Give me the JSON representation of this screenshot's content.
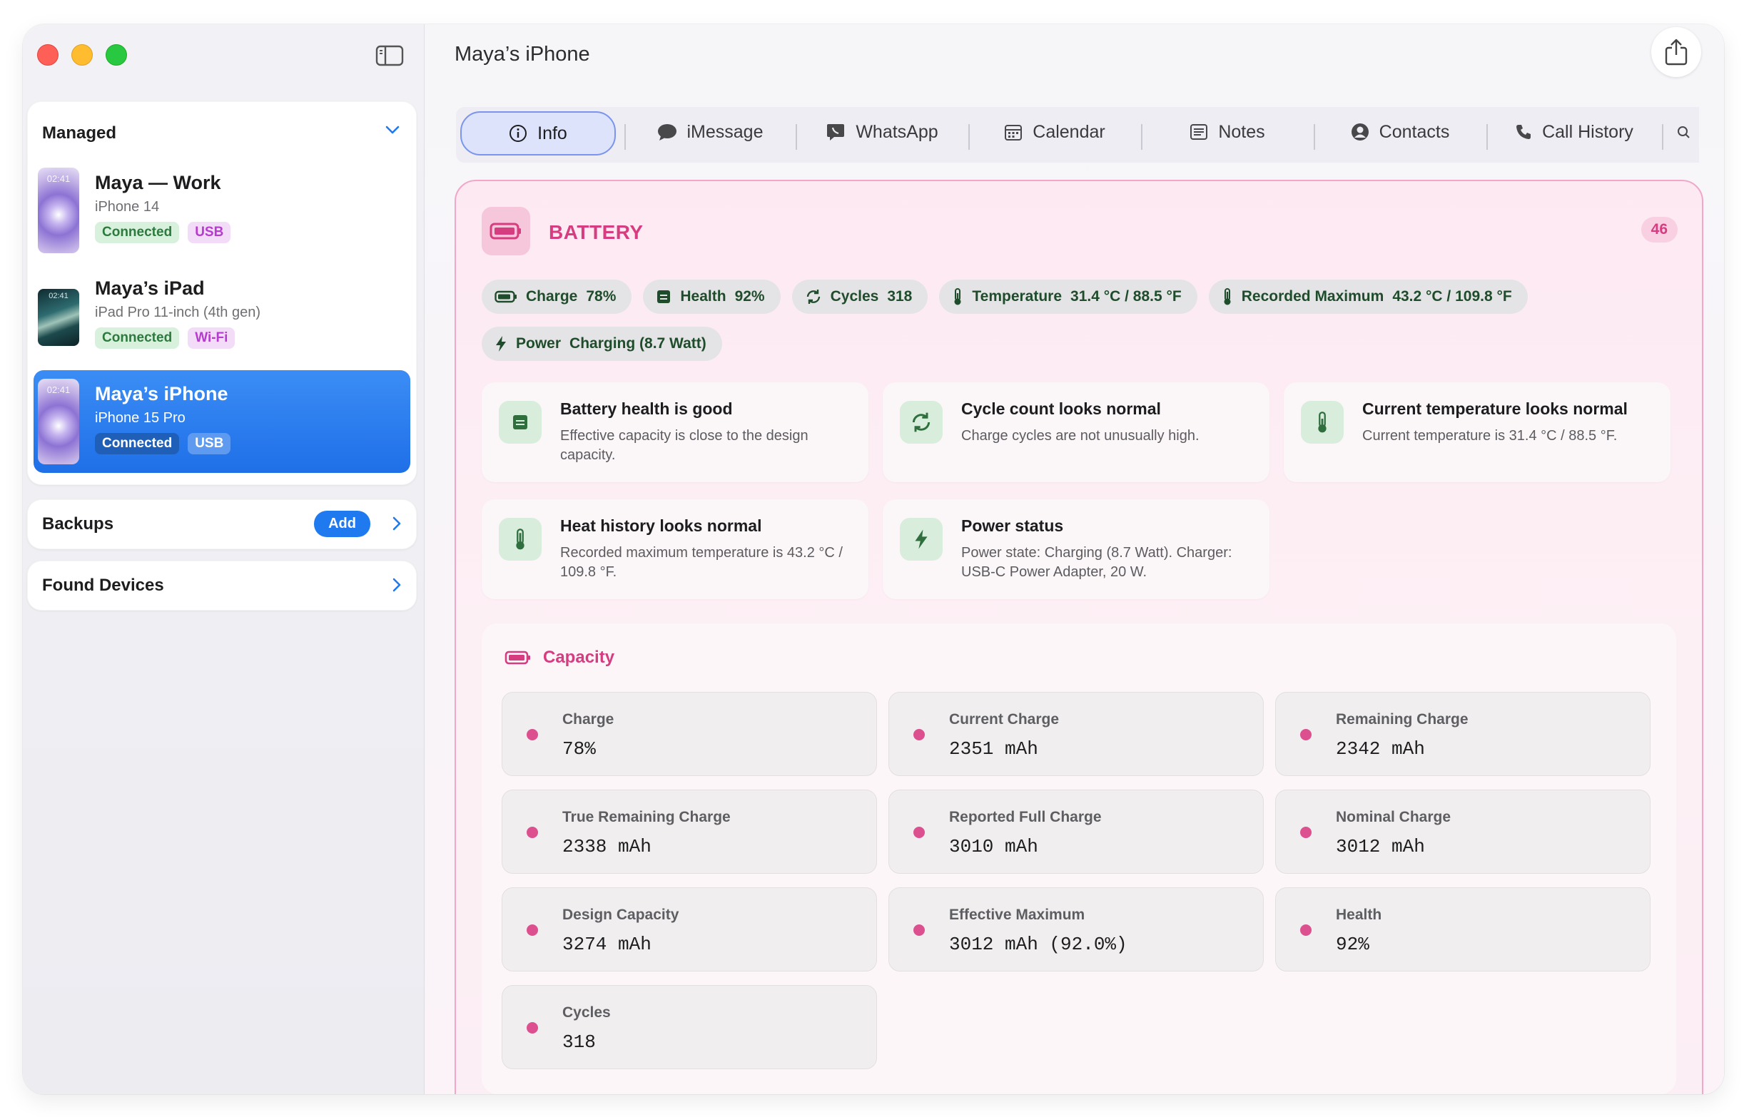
{
  "window": {
    "title": "Maya’s iPhone"
  },
  "sidebar": {
    "managed_title": "Managed",
    "devices": [
      {
        "name": "Maya — Work",
        "model": "iPhone 14",
        "status": "Connected",
        "connection": "USB",
        "thumb_time": "02:41"
      },
      {
        "name": "Maya’s iPad",
        "model": "iPad Pro 11-inch (4th gen)",
        "status": "Connected",
        "connection": "Wi-Fi",
        "thumb_time": "02:41"
      },
      {
        "name": "Maya’s iPhone",
        "model": "iPhone 15 Pro",
        "status": "Connected",
        "connection": "USB",
        "thumb_time": "02:41"
      }
    ],
    "backups_title": "Backups",
    "backups_add": "Add",
    "found_title": "Found Devices"
  },
  "tabs": [
    {
      "label": "Info",
      "icon": "info-icon"
    },
    {
      "label": "iMessage",
      "icon": "message-bubble-icon"
    },
    {
      "label": "WhatsApp",
      "icon": "whatsapp-icon"
    },
    {
      "label": "Calendar",
      "icon": "calendar-icon"
    },
    {
      "label": "Notes",
      "icon": "notes-icon"
    },
    {
      "label": "Contacts",
      "icon": "contacts-icon"
    },
    {
      "label": "Call History",
      "icon": "phone-icon"
    }
  ],
  "battery": {
    "title": "BATTERY",
    "count": "46",
    "chips": [
      {
        "label": "Charge",
        "value": "78%",
        "icon": "battery-icon"
      },
      {
        "label": "Health",
        "value": "92%",
        "icon": "health-icon"
      },
      {
        "label": "Cycles",
        "value": "318",
        "icon": "cycle-icon"
      },
      {
        "label": "Temperature",
        "value": "31.4 °C / 88.5 °F",
        "icon": "thermometer-icon"
      },
      {
        "label": "Recorded Maximum",
        "value": "43.2 °C / 109.8 °F",
        "icon": "thermometer-icon"
      },
      {
        "label": "Power",
        "value": "Charging (8.7 Watt)",
        "icon": "bolt-icon"
      }
    ],
    "insights": [
      {
        "title": "Battery health is good",
        "desc": "Effective capacity is close to the design capacity."
      },
      {
        "title": "Cycle count looks normal",
        "desc": "Charge cycles are not unusually high."
      },
      {
        "title": "Current temperature looks normal",
        "desc": "Current temperature is 31.4 °C / 88.5 °F."
      },
      {
        "title": "Heat history looks normal",
        "desc": "Recorded maximum temperature is 43.2 °C / 109.8 °F."
      },
      {
        "title": "Power status",
        "desc": "Power state: Charging (8.7 Watt). Charger: USB-C Power Adapter, 20 W."
      }
    ],
    "capacity": {
      "title": "Capacity",
      "metrics": [
        {
          "label": "Charge",
          "value": "78%"
        },
        {
          "label": "Current Charge",
          "value": "2351 mAh"
        },
        {
          "label": "Remaining Charge",
          "value": "2342 mAh"
        },
        {
          "label": "True Remaining Charge",
          "value": "2338 mAh"
        },
        {
          "label": "Reported Full Charge",
          "value": "3010 mAh"
        },
        {
          "label": "Nominal Charge",
          "value": "3012 mAh"
        },
        {
          "label": "Design Capacity",
          "value": "3274 mAh"
        },
        {
          "label": "Effective Maximum",
          "value": "3012 mAh (92.0%)"
        },
        {
          "label": "Health",
          "value": "92%"
        },
        {
          "label": "Cycles",
          "value": "318"
        }
      ]
    }
  },
  "colors": {
    "accent": "#1f7af0",
    "battery_pink": "#d63c80",
    "status_green": "#2d7a3e"
  }
}
